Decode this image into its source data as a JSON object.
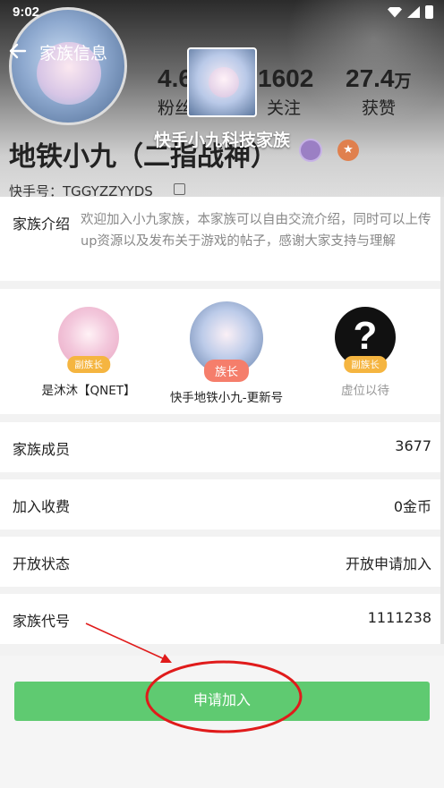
{
  "status_bar": {
    "time": "9:02"
  },
  "header": {
    "back_icon": "arrow-left-icon",
    "title": "家族信息",
    "stats": [
      {
        "value": "4.6",
        "label": "粉丝"
      },
      {
        "value": "1602",
        "label": "关注"
      },
      {
        "value": "27.4",
        "unit": "万",
        "label": "获赞"
      }
    ],
    "family_name": "快手小九科技家族",
    "user_name": "地铁小九（二指战神）",
    "kuaishou_id": "快手号：TGGYZZYYDS"
  },
  "intro": {
    "label": "家族介绍",
    "text": "欢迎加入小九家族，本家族可以自由交流介绍，同时可以上传up资源以及发布关于游戏的帖子，感谢大家支持与理解"
  },
  "leaders": [
    {
      "name": "是沐沐【QNET】",
      "role": "副族长"
    },
    {
      "name": "快手地铁小九-更新号",
      "role": "族长"
    },
    {
      "name": "虚位以待",
      "role": "副族长"
    }
  ],
  "info_rows": [
    {
      "label": "家族成员",
      "value": "3677"
    },
    {
      "label": "加入收费",
      "value": "0金币"
    },
    {
      "label": "开放状态",
      "value": "开放申请加入"
    },
    {
      "label": "家族代号",
      "value": "1111238"
    }
  ],
  "apply_button": {
    "label": "申请加入"
  },
  "colors": {
    "primary_button": "#5fca71",
    "chief_tag": "#f57e6b",
    "vice_tag": "#f5b540",
    "annotation": "#e01b1b"
  }
}
